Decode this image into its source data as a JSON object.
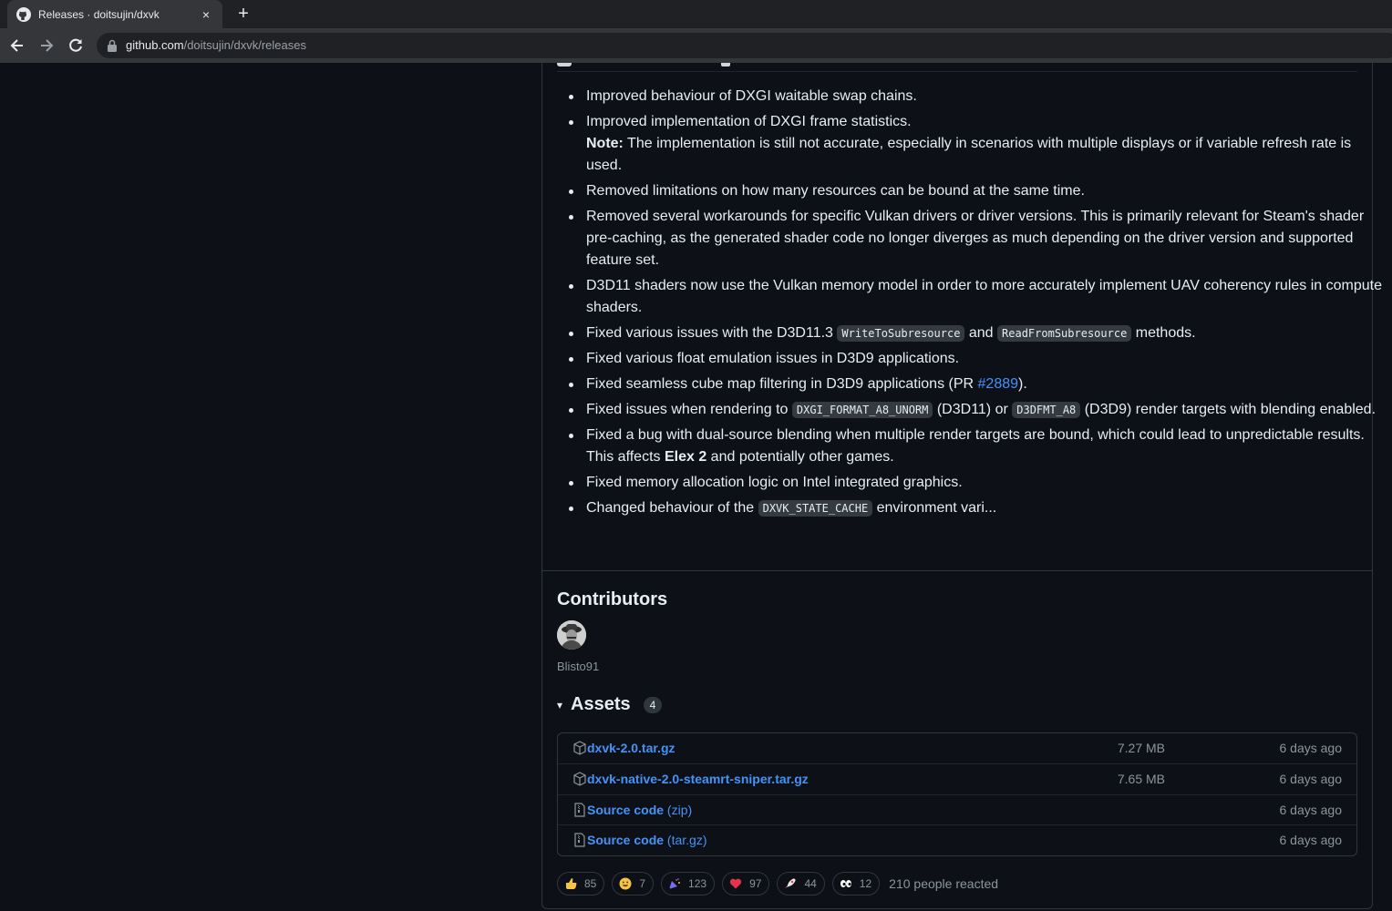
{
  "browser": {
    "tab_title": "Releases · doitsujin/dxvk",
    "tab_close": "×",
    "new_tab": "+",
    "url_host": "github.com",
    "url_path": "/doitsujin/dxvk/releases"
  },
  "notes": {
    "items": [
      {
        "text": "Improved behaviour of DXGI waitable swap chains."
      },
      {
        "text": "Improved implementation of DXGI frame statistics.",
        "note_label": "Note:",
        "note_text": " The implementation is still not accurate, especially in scenarios with multiple displays or if variable refresh rate is used."
      },
      {
        "text": "Removed limitations on how many resources can be bound at the same time."
      },
      {
        "text": "Removed several workarounds for specific Vulkan drivers or driver versions. This is primarily relevant for Steam's shader pre-caching, as the generated shader code no longer diverges as much depending on the driver version and supported feature set."
      },
      {
        "text": "D3D11 shaders now use the Vulkan memory model in order to more accurately implement UAV coherency rules in compute shaders."
      },
      {
        "a": "Fixed various issues with the D3D11.3 ",
        "code1": "WriteToSubresource",
        "b": " and ",
        "code2": "ReadFromSubresource",
        "c": " methods."
      },
      {
        "text": "Fixed various float emulation issues in D3D9 applications."
      },
      {
        "a": "Fixed seamless cube map filtering in D3D9 applications (PR ",
        "link": "#2889",
        "c": ")."
      },
      {
        "a": "Fixed issues when rendering to ",
        "code1": "DXGI_FORMAT_A8_UNORM",
        "b": " (D3D11) or ",
        "code2": "D3DFMT_A8",
        "c": " (D3D9) render targets with blending enabled."
      },
      {
        "a": "Fixed a bug with dual-source blending when multiple render targets are bound, which could lead to unpredictable results. This affects ",
        "bold": "Elex 2",
        "c": " and potentially other games."
      },
      {
        "text": "Fixed memory allocation logic on Intel integrated graphics."
      },
      {
        "a": "Changed behaviour of the ",
        "code1": "DXVK_STATE_CACHE",
        "c": " environment vari..."
      }
    ]
  },
  "contributors": {
    "title": "Contributors",
    "name": "Blisto91"
  },
  "assets": {
    "caret": "▾",
    "title": "Assets",
    "count": "4",
    "rows": [
      {
        "name": "dxvk-2.0.tar.gz",
        "fmt": "",
        "size": "7.27 MB",
        "date": "6 days ago",
        "icon": "package-icon"
      },
      {
        "name": "dxvk-native-2.0-steamrt-sniper.tar.gz",
        "fmt": "",
        "size": "7.65 MB",
        "date": "6 days ago",
        "icon": "package-icon"
      },
      {
        "name": "Source code",
        "fmt": " (zip)",
        "size": "",
        "date": "6 days ago",
        "icon": "file-zip-icon"
      },
      {
        "name": "Source code",
        "fmt": " (tar.gz)",
        "size": "",
        "date": "6 days ago",
        "icon": "file-zip-icon"
      }
    ]
  },
  "reactions": {
    "items": [
      {
        "emoji": "thumbs-up",
        "count": "85",
        "color": "#f5c542"
      },
      {
        "emoji": "smile",
        "count": "7",
        "color": "#f5c542"
      },
      {
        "emoji": "tada",
        "count": "123",
        "color": "#7a6cf2"
      },
      {
        "emoji": "heart",
        "count": "97",
        "color": "#e5334b"
      },
      {
        "emoji": "rocket",
        "count": "44",
        "color": "#e8e8e8"
      },
      {
        "emoji": "eyes",
        "count": "12",
        "color": "#ffffff"
      }
    ],
    "summary": "210 people reacted"
  },
  "colors": {
    "background": "#0d1117",
    "link": "#4493f8",
    "border": "#30363d",
    "muted": "#8b949e"
  }
}
